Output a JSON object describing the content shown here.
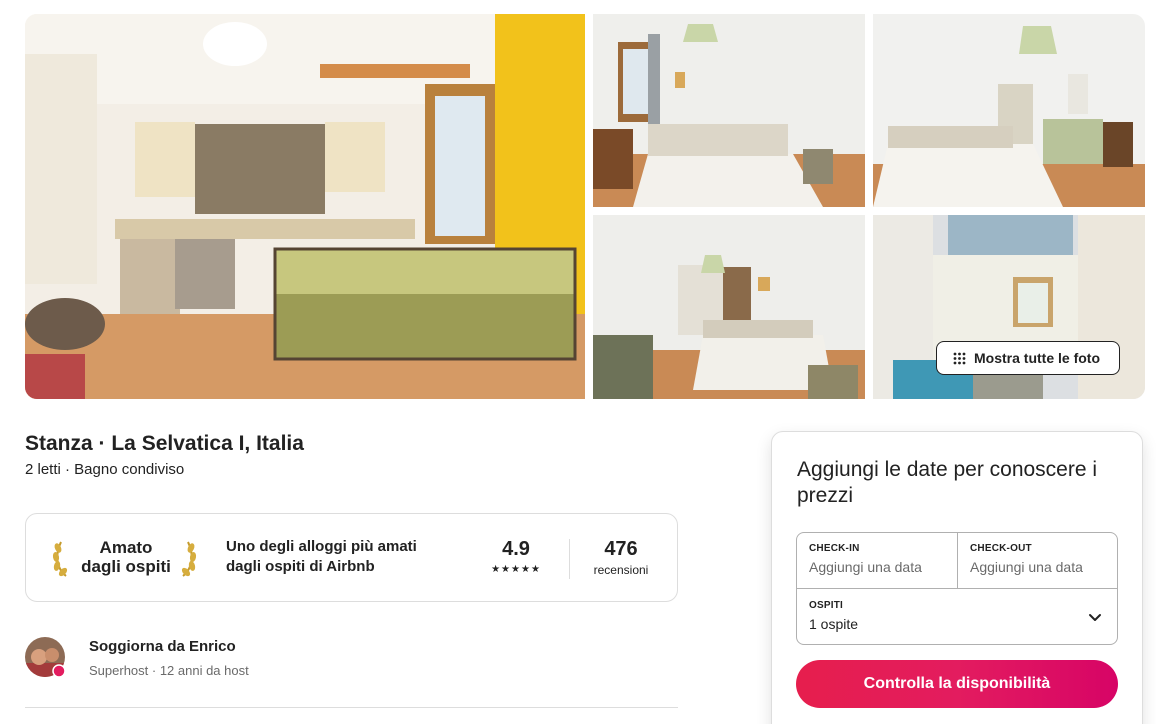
{
  "gallery": {
    "show_all_label": "Mostra tutte le foto"
  },
  "listing": {
    "title": "Stanza · La Selvatica I, Italia",
    "subtitle": "2 letti · Bagno condiviso"
  },
  "guest_favorite": {
    "badge_line1": "Amato",
    "badge_line2": "dagli ospiti",
    "description": "Uno degli alloggi più amati dagli ospiti di Airbnb",
    "rating": "4.9",
    "stars": "★★★★★",
    "reviews_count": "476",
    "reviews_label": "recensioni"
  },
  "host": {
    "name": "Soggiorna da Enrico",
    "meta": "Superhost · 12 anni da host"
  },
  "booking": {
    "heading": "Aggiungi le date per conoscere i prezzi",
    "checkin_label": "CHECK-IN",
    "checkin_value": "Aggiungi una data",
    "checkout_label": "CHECK-OUT",
    "checkout_value": "Aggiungi una data",
    "guests_label": "OSPITI",
    "guests_value": "1 ospite",
    "button_label": "Controlla la disponibilità"
  },
  "colors": {
    "brand": "#e31c5f",
    "text": "#222222",
    "muted": "#6a6a6a",
    "border": "#dddddd",
    "kitchen_wall": "#f2c21b"
  },
  "icons": {
    "show_all": "grid-dots-icon",
    "guests_dropdown": "chevron-down-icon",
    "laurel": "laurel-icon",
    "superhost": "superhost-badge-icon"
  }
}
